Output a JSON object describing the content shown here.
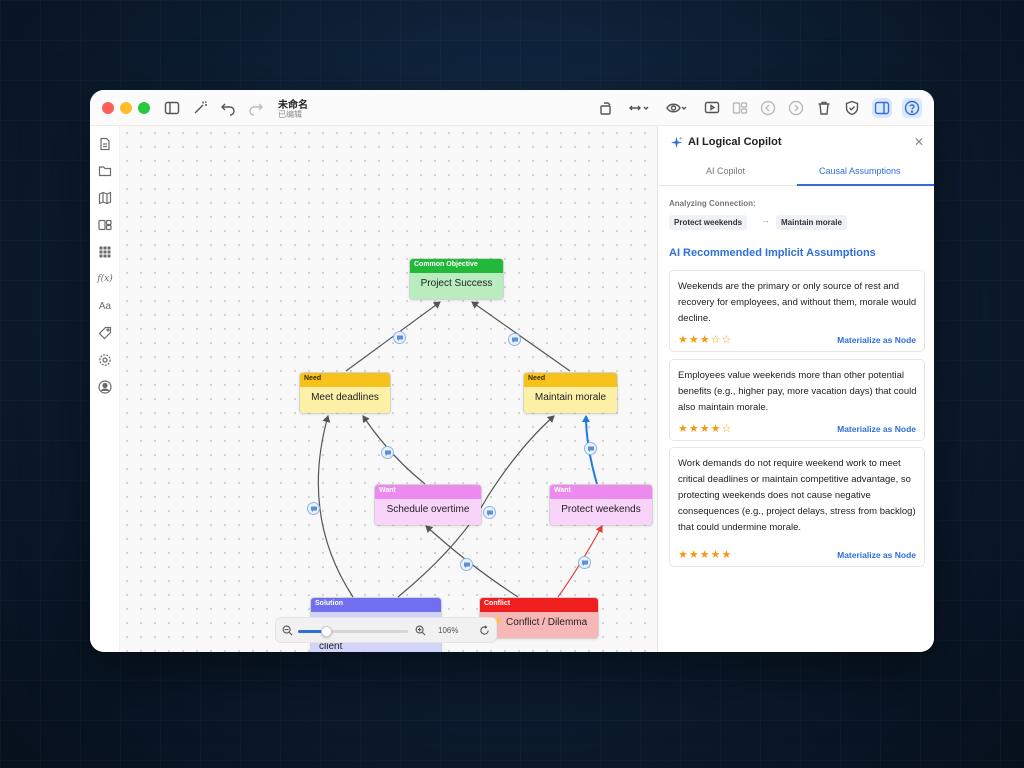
{
  "app": {
    "doc_title": "未命名",
    "doc_status": "已编辑"
  },
  "colors": {
    "accent": "#2f6fd6",
    "objective": "#22b83a",
    "need": "#f7c21b",
    "want": "#ec8af0",
    "solution": "#6f6ff0",
    "conflict": "#ef1f1f"
  },
  "toolbar": {
    "left_icons": [
      "sidebar-toggle-icon",
      "magic-wand-icon",
      "undo-icon",
      "redo-icon"
    ],
    "right_icons": [
      "rotate-icon",
      "expand-horizontal-icon",
      "eye-icon",
      "present-icon",
      "layout-icon",
      "back-icon",
      "forward-icon",
      "trash-icon",
      "shield-icon",
      "panel-icon",
      "help-icon"
    ]
  },
  "sidebar": {
    "items": [
      "document-icon",
      "folder-icon",
      "map-icon",
      "layout-icon",
      "grid-icon",
      "function-icon",
      "text-style-icon",
      "tag-icon",
      "settings-icon",
      "user-icon"
    ],
    "fx_label": "f(x)",
    "aa_label": "Aa"
  },
  "canvas": {
    "nodes": {
      "objective": {
        "type": "Common Objective",
        "label": "Project Success"
      },
      "need1": {
        "type": "Need",
        "label": "Meet deadlines"
      },
      "need2": {
        "type": "Need",
        "label": "Maintain morale"
      },
      "want1": {
        "type": "Want",
        "label": "Schedule overtime"
      },
      "want2": {
        "type": "Want",
        "label": "Protect weekends"
      },
      "solution": {
        "type": "Solution",
        "label": "Implement formal change control process with client"
      },
      "conflict": {
        "type": "Conflict",
        "label": "Conflict / Dilemma"
      }
    },
    "zoom": {
      "label": "106%",
      "level": 0.25
    }
  },
  "panel": {
    "title": "AI Logical Copilot",
    "tabs": [
      {
        "label": "AI Copilot",
        "active": false
      },
      {
        "label": "Causal Assumptions",
        "active": true
      }
    ],
    "analyzing_label": "Analyzing Connection:",
    "connection_from": "Protect weekends",
    "connection_to": "Maintain morale",
    "arrow": "→",
    "section_title": "AI Recommended Implicit Assumptions",
    "action_label": "Materialize as Node",
    "assumptions": [
      {
        "text": "Weekends are the primary or only source of rest and recovery for employees, and without them, morale would decline.",
        "stars": "★★★☆☆",
        "rating": 3
      },
      {
        "text": "Employees value weekends more than other potential benefits (e.g., higher pay, more vacation days) that could also maintain morale.",
        "stars": "★★★★☆",
        "rating": 4
      },
      {
        "text": "Work demands do not require weekend work to meet critical deadlines or maintain competitive advantage, so protecting weekends does not cause negative consequences (e.g., project delays, stress from backlog) that could undermine morale.",
        "stars": "★★★★★",
        "rating": 5
      }
    ]
  }
}
